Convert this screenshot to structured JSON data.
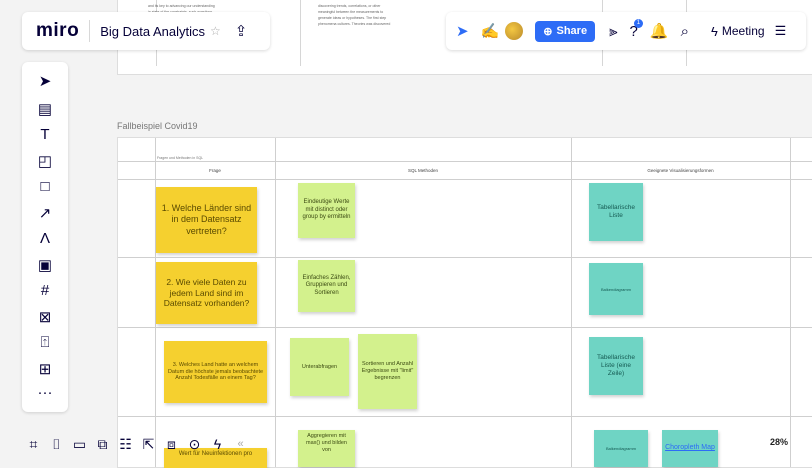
{
  "app": {
    "logo": "miro",
    "board_title": "Big Data Analytics",
    "star_icon": "☆",
    "upload_icon": "⇪"
  },
  "topbar_right": {
    "share_label": "Share",
    "meeting_label": "Meeting",
    "notification_count": "1"
  },
  "doc_snippet": {
    "lines": [
      "and its key to advancing our understanding",
      "in state of the constraints, such questions",
      "discovering trends, correlations, or other",
      "meaningful between the measurements to",
      "generate ideas or hypotheses. The first step",
      "phenomena cultures. Theories was discovered"
    ]
  },
  "frame": {
    "label": "Fallbeispiel Covid19",
    "small_header": "Fragen und Methoden in SQL",
    "columns": [
      "Frage",
      "SQL Methoden",
      "Geeignete Visualisierungsformen"
    ]
  },
  "rows": [
    {
      "question": "1. Welche Länder sind in dem Datensatz vertreten?",
      "methods": [
        "Eindeutige Werte mit distinct oder group by ermitteln"
      ],
      "viz": [
        "Tabellarische Liste"
      ]
    },
    {
      "question": "2. Wie viele Daten zu jedem Land sind im Datensatz vorhanden?",
      "methods": [
        "Einfaches Zählen, Gruppieren und Sortieren"
      ],
      "viz": [
        "Balkendiagramm"
      ]
    },
    {
      "question": "3. Welches Land hatte an welchem Datum die höchste jemals beobachtete Anzahl Todesfälle an einem Tag?",
      "methods": [
        "Unterabfragen",
        "Sortieren und Anzahl Ergebnisse mit \"limit\" begrenzen"
      ],
      "viz": [
        "Tabellarische Liste (eine Zeile)"
      ]
    },
    {
      "question": "Wert für Neuinfektionen pro",
      "methods": [
        "Aggregieren mit max() und bilden von"
      ],
      "viz": [
        "Balkendiagramm",
        "Choropleth Map"
      ]
    }
  ],
  "bottom": {
    "zoom": "28%",
    "collapse": "«"
  }
}
